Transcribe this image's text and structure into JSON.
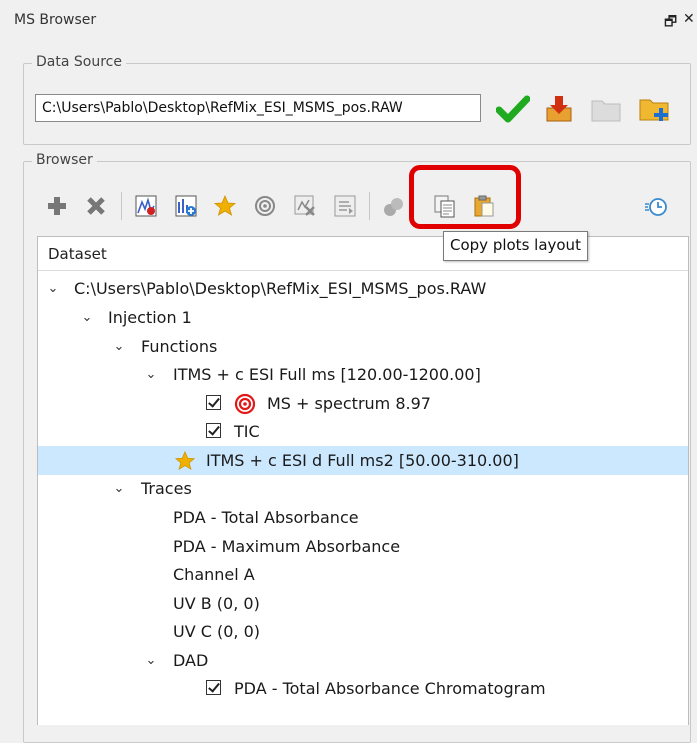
{
  "window": {
    "title": "MS Browser",
    "float_glyph": "🗗",
    "close_glyph": "✕"
  },
  "data_source": {
    "label": "Data Source",
    "path": "C:\\Users\\Pablo\\Desktop\\RefMix_ESI_MSMS_pos.RAW",
    "buttons": [
      {
        "name": "confirm-icon",
        "color": "#1faa1f"
      },
      {
        "name": "import-icon",
        "color": "#d06010"
      },
      {
        "name": "folder-icon",
        "color": "#d0d0d0"
      },
      {
        "name": "folder-add-icon",
        "color": "#e8b020"
      }
    ]
  },
  "browser": {
    "label": "Browser",
    "tooltip": "Copy plots layout",
    "toolbar": [
      "add-icon",
      "remove-icon",
      "plot-spectrum-icon",
      "add-plot-icon",
      "star-icon",
      "target-icon",
      "remove-plot-icon",
      "arrange-icon",
      "group-icon",
      "copy-layout-icon",
      "paste-layout-icon",
      "timer-icon"
    ]
  },
  "tree": {
    "header": "Dataset",
    "rows": [
      {
        "text": "C:\\Users\\Pablo\\Desktop\\RefMix_ESI_MSMS_pos.RAW",
        "level": 0,
        "expander": "down"
      },
      {
        "text": "Injection 1",
        "level": 1,
        "expander": "down"
      },
      {
        "text": "Functions",
        "level": 2,
        "expander": "down"
      },
      {
        "text": "ITMS + c ESI Full ms [120.00-1200.00]",
        "level": 3,
        "expander": "down"
      },
      {
        "text": "MS + spectrum 8.97",
        "level": 4,
        "checkbox": true,
        "icon": "target-icon"
      },
      {
        "text": "TIC",
        "level": 4,
        "checkbox": true
      },
      {
        "text": "ITMS + c ESI d Full ms2 [50.00-310.00]",
        "level": 3,
        "icon": "star-icon",
        "selected": true
      },
      {
        "text": "Traces",
        "level": 2,
        "expander": "down"
      },
      {
        "text": "PDA - Total Absorbance",
        "level": 3
      },
      {
        "text": "PDA - Maximum Absorbance",
        "level": 3
      },
      {
        "text": "Channel A",
        "level": 3
      },
      {
        "text": "UV B (0, 0)",
        "level": 3
      },
      {
        "text": "UV C (0, 0)",
        "level": 3
      },
      {
        "text": "DAD",
        "level": 3,
        "expander": "down"
      },
      {
        "text": "PDA - Total Absorbance Chromatogram",
        "level": 4,
        "checkbox": true
      }
    ]
  }
}
